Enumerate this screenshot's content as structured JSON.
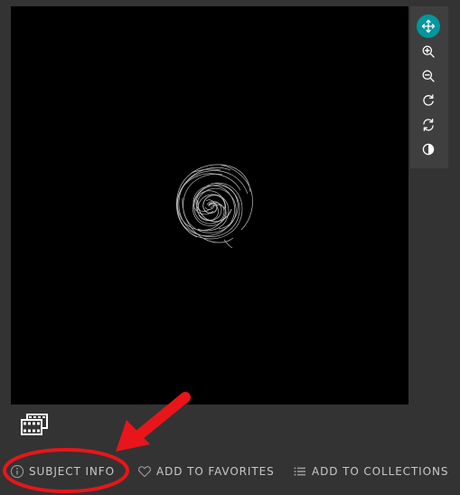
{
  "viewer": {
    "image_alt": "spiral galaxy subject image"
  },
  "toolbar": {
    "tools": [
      {
        "icon": "move-icon",
        "active": true
      },
      {
        "icon": "zoom-in-icon",
        "active": false
      },
      {
        "icon": "zoom-out-icon",
        "active": false
      },
      {
        "icon": "rotate-icon",
        "active": false
      },
      {
        "icon": "reset-icon",
        "active": false
      },
      {
        "icon": "invert-icon",
        "active": false
      }
    ],
    "accent_color": "#00979d"
  },
  "filmstrip": {
    "icon": "film-frames-icon"
  },
  "actions": {
    "subject_info_label": "SUBJECT INFO",
    "favorites_label": "ADD TO FAVORITES",
    "collections_label": "ADD TO COLLECTIONS"
  },
  "annotation": {
    "color": "#e8151b",
    "shapes": [
      "arrow",
      "ellipse"
    ]
  }
}
